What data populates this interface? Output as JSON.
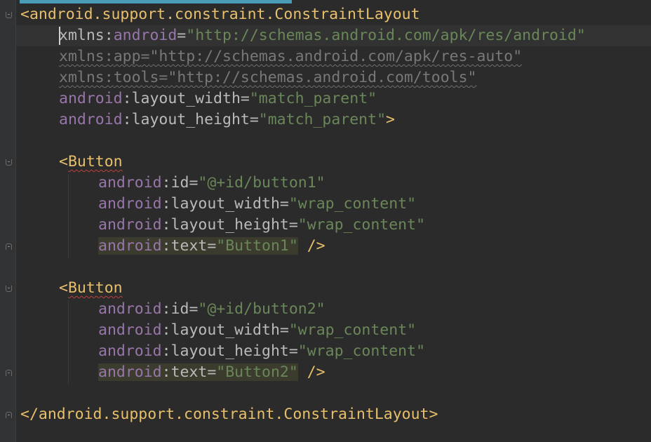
{
  "editor": {
    "root": {
      "open_tag": "<android.support.constraint.ConstraintLayout",
      "close_tag": "</android.support.constraint.ConstraintLayout>",
      "attributes": [
        {
          "ns": "xmlns",
          "colon": ":",
          "name": "android",
          "eq": "=",
          "value": "\"http://schemas.android.com/apk/res/android\"",
          "end": ""
        },
        {
          "ns": "xmlns",
          "colon": ":",
          "name": "app",
          "eq": "=",
          "value": "\"http://schemas.android.com/apk/res-auto\"",
          "end": ""
        },
        {
          "ns": "xmlns",
          "colon": ":",
          "name": "tools",
          "eq": "=",
          "value": "\"http://schemas.android.com/tools\"",
          "end": ""
        },
        {
          "ns": "android",
          "colon": ":",
          "name": "layout_width",
          "eq": "=",
          "value": "\"match_parent\"",
          "end": ""
        },
        {
          "ns": "android",
          "colon": ":",
          "name": "layout_height",
          "eq": "=",
          "value": "\"match_parent\"",
          "end": ">"
        }
      ]
    },
    "buttons": [
      {
        "open_tag": "<",
        "tag_name": "Button",
        "attributes": [
          {
            "ns": "android",
            "colon": ":",
            "name": "id",
            "eq": "=",
            "value": "\"@+id/button1\"",
            "end": ""
          },
          {
            "ns": "android",
            "colon": ":",
            "name": "layout_width",
            "eq": "=",
            "value": "\"wrap_content\"",
            "end": ""
          },
          {
            "ns": "android",
            "colon": ":",
            "name": "layout_height",
            "eq": "=",
            "value": "\"wrap_content\"",
            "end": ""
          },
          {
            "ns": "android",
            "colon": ":",
            "name": "text",
            "eq": "=",
            "value": "\"Button1\"",
            "end": " />"
          }
        ]
      },
      {
        "open_tag": "<",
        "tag_name": "Button",
        "attributes": [
          {
            "ns": "android",
            "colon": ":",
            "name": "id",
            "eq": "=",
            "value": "\"@+id/button2\"",
            "end": ""
          },
          {
            "ns": "android",
            "colon": ":",
            "name": "layout_width",
            "eq": "=",
            "value": "\"wrap_content\"",
            "end": ""
          },
          {
            "ns": "android",
            "colon": ":",
            "name": "layout_height",
            "eq": "=",
            "value": "\"wrap_content\"",
            "end": ""
          },
          {
            "ns": "android",
            "colon": ":",
            "name": "text",
            "eq": "=",
            "value": "\"Button2\"",
            "end": " />"
          }
        ]
      }
    ]
  },
  "colors": {
    "background": "#2b2b2b",
    "tag": "#e8bf6a",
    "namespace": "#9876aa",
    "attribute": "#bababa",
    "string": "#6a8759",
    "unused": "#787878",
    "warning_underline": "#bc3f3c"
  }
}
